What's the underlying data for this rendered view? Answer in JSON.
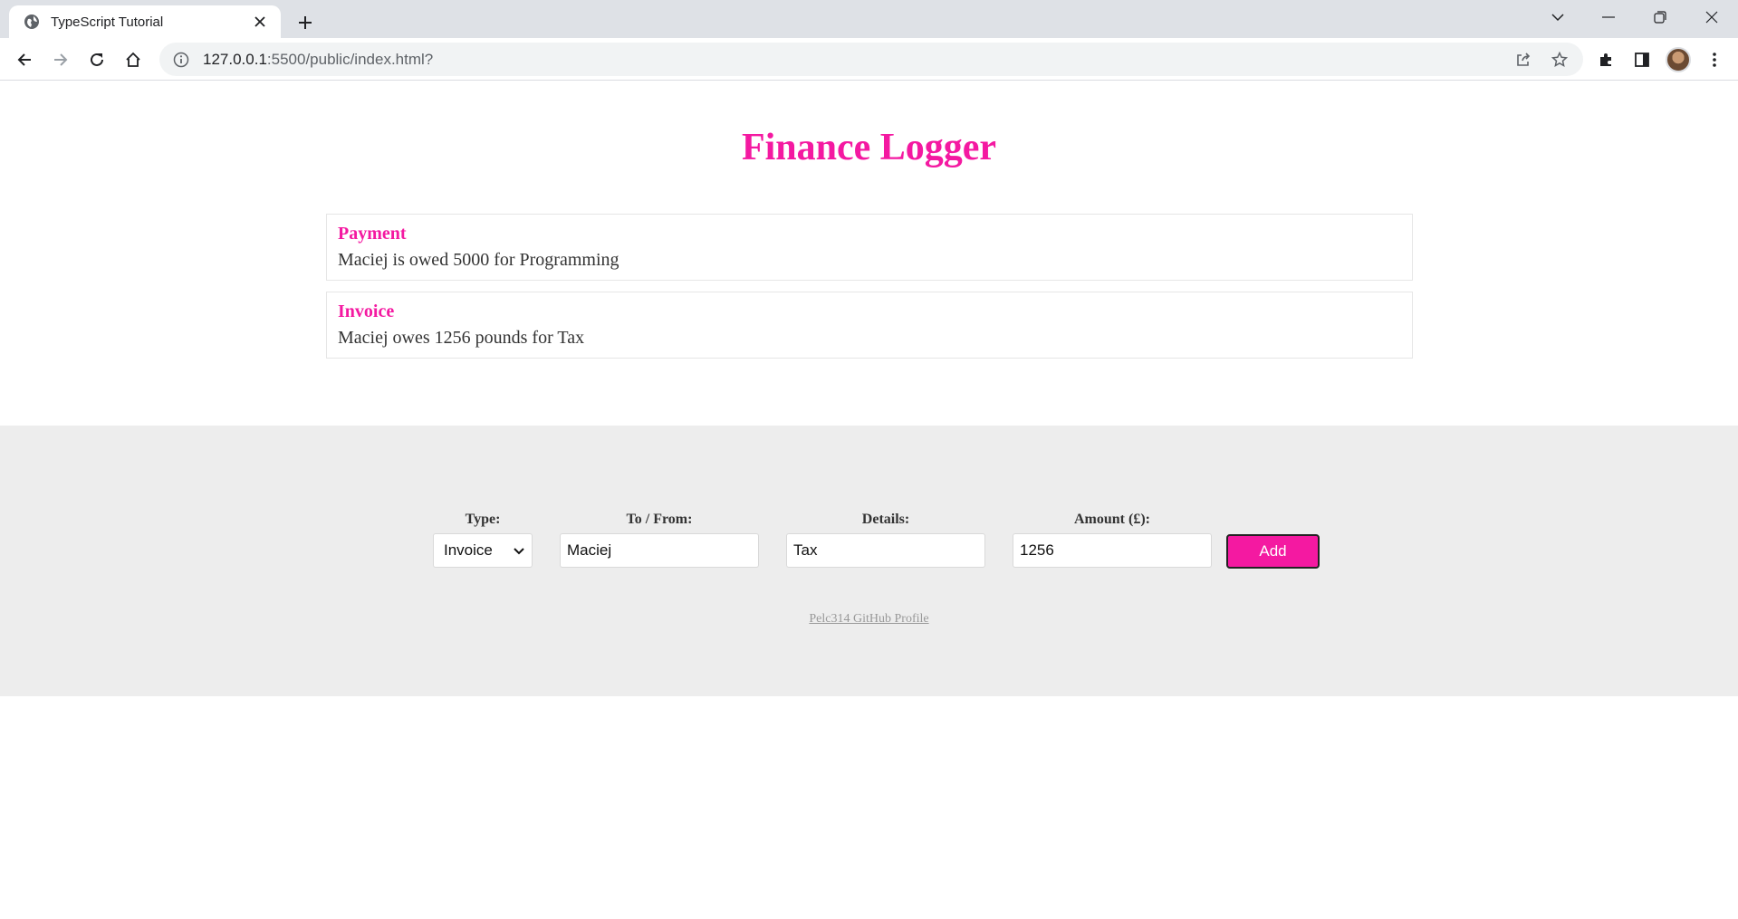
{
  "browser": {
    "tab_title": "TypeScript Tutorial",
    "url_host": "127.0.0.1",
    "url_path": ":5500/public/index.html?"
  },
  "page": {
    "title": "Finance Logger",
    "items": [
      {
        "type": "Payment",
        "text": "Maciej is owed 5000 for Programming"
      },
      {
        "type": "Invoice",
        "text": "Maciej owes 1256 pounds for Tax"
      }
    ]
  },
  "form": {
    "type_label": "Type:",
    "type_value": "Invoice",
    "tofrom_label": "To / From:",
    "tofrom_value": "Maciej",
    "details_label": "Details:",
    "details_value": "Tax",
    "amount_label": "Amount (£):",
    "amount_value": "1256",
    "add_label": "Add"
  },
  "footer": {
    "github_link": "Pelc314 GitHub Profile"
  },
  "colors": {
    "accent": "#f419a1",
    "band": "#ededed"
  }
}
